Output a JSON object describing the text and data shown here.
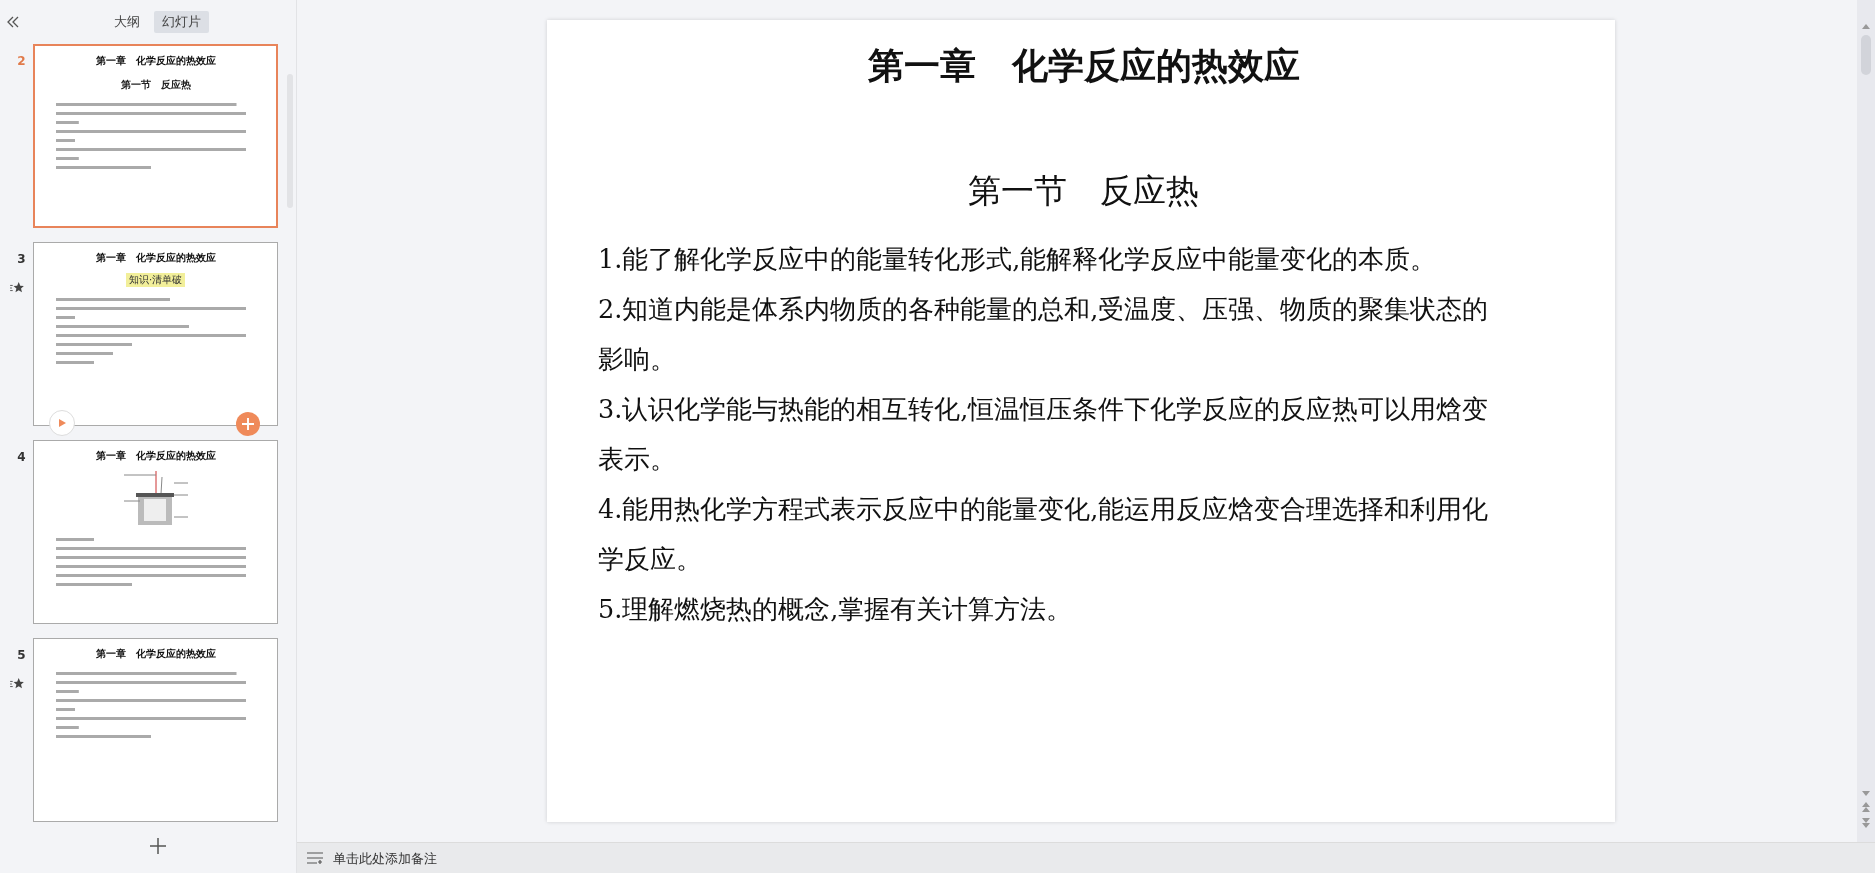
{
  "sidebar": {
    "tabs": [
      {
        "label": "大纲",
        "selected": false
      },
      {
        "label": "幻灯片",
        "selected": true
      }
    ],
    "slides": [
      {
        "number": "2",
        "selected": true,
        "animated": false,
        "hovered": false,
        "kind": "text",
        "title": "第一章　化学反应的热效应",
        "subtitle": "第一节　反应热"
      },
      {
        "number": "3",
        "selected": false,
        "animated": true,
        "hovered": true,
        "kind": "list",
        "title": "第一章　化学反应的热效应",
        "tag": "知识·清单破"
      },
      {
        "number": "4",
        "selected": false,
        "animated": false,
        "hovered": false,
        "kind": "diagram",
        "title": "第一章　化学反应的热效应"
      },
      {
        "number": "5",
        "selected": false,
        "animated": true,
        "hovered": false,
        "kind": "text",
        "title": "第一章　化学反应的热效应"
      }
    ]
  },
  "slide": {
    "title": "第一章　化学反应的热效应",
    "subtitle": "第一节　反应热",
    "paragraphs": [
      "1.能了解化学反应中的能量转化形式,能解释化学反应中能量变化的本质。",
      "2.知道内能是体系内物质的各种能量的总和,受温度、压强、物质的聚集状态的影响。",
      "3.认识化学能与热能的相互转化,恒温恒压条件下化学反应的反应热可以用焓变表示。",
      "4.能用热化学方程式表示反应中的能量变化,能运用反应焓变合理选择和利用化学反应。",
      "5.理解燃烧热的概念,掌握有关计算方法。"
    ]
  },
  "notes": {
    "placeholder": "单击此处添加备注"
  }
}
